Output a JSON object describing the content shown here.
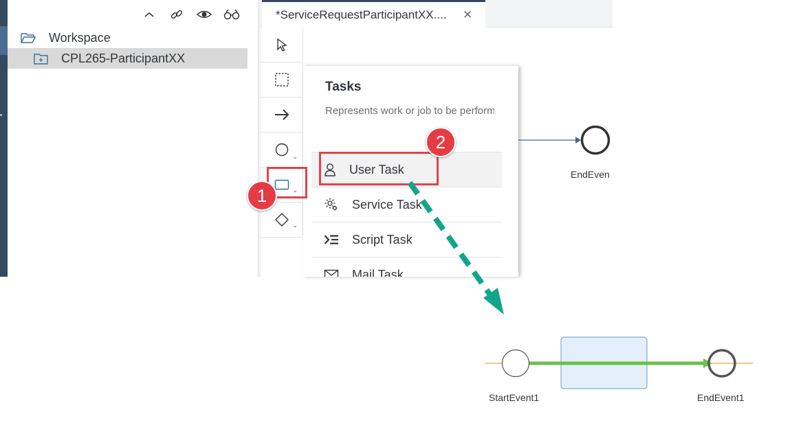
{
  "workspace": {
    "toolbar_icons": [
      "collapse-icon",
      "link-icon",
      "eye-icon",
      "binoculars-icon"
    ],
    "root_label": "Workspace",
    "project_label": "CPL265-ParticipantXX"
  },
  "editor": {
    "tab_title": "*ServiceRequestParticipantXX....",
    "tab_close": "✕"
  },
  "palette": {
    "tools": [
      "pointer-tool",
      "lasso-tool",
      "sequence-flow-tool",
      "event-tool",
      "task-tool",
      "gateway-tool"
    ]
  },
  "popover": {
    "title": "Tasks",
    "description": "Represents work or job to be perform",
    "items": [
      {
        "label": "User Task",
        "icon": "user-icon"
      },
      {
        "label": "Service Task",
        "icon": "gear-icon"
      },
      {
        "label": "Script Task",
        "icon": "script-icon"
      },
      {
        "label": "Mail Task",
        "icon": "mail-icon"
      }
    ]
  },
  "canvas": {
    "end_event_label": "EndEven"
  },
  "annotations": {
    "step1": "1",
    "step2": "2"
  },
  "result_diagram": {
    "start_label": "StartEvent1",
    "end_label": "EndEvent1"
  },
  "colors": {
    "shell_dark": "#354a5f",
    "annotation_red": "#e0434b",
    "badge_red": "#e53b45",
    "arrow_teal": "#12a58a",
    "flow_green": "#6cc04a",
    "flow_orange": "#f5a142",
    "task_fill": "#e3f0fb",
    "task_border": "#7fa9d6"
  }
}
